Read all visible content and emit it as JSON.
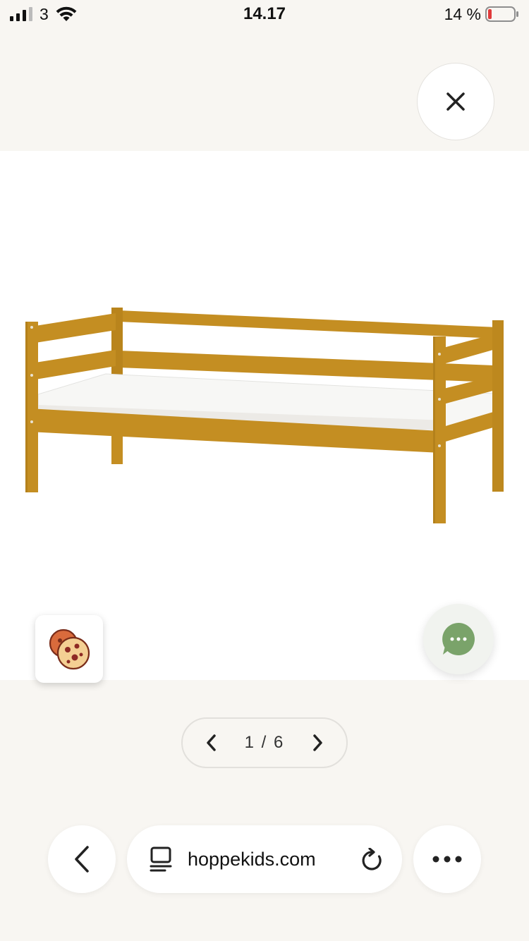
{
  "status_bar": {
    "carrier": "3",
    "time": "14.17",
    "battery_percent": "14 %",
    "battery_level": 0.14,
    "battery_color": "#e03a3a"
  },
  "gallery": {
    "close_icon": "close-icon",
    "current_page": "1",
    "total_pages": "6",
    "pager_label": "1 / 6",
    "prev_icon": "chevron-left-icon",
    "next_icon": "chevron-right-icon",
    "bed_color": "#c48e22",
    "mattress_color": "#f7f7f5"
  },
  "floating": {
    "cookie_icon": "cookie-icon",
    "chat_icon": "chat-bubble-icon",
    "chat_color": "#7aa36a"
  },
  "browser_toolbar": {
    "back_icon": "chevron-left-icon",
    "tab_icon": "reader-icon",
    "url": "hoppekids.com",
    "reload_icon": "reload-icon",
    "more_icon": "more-icon"
  }
}
